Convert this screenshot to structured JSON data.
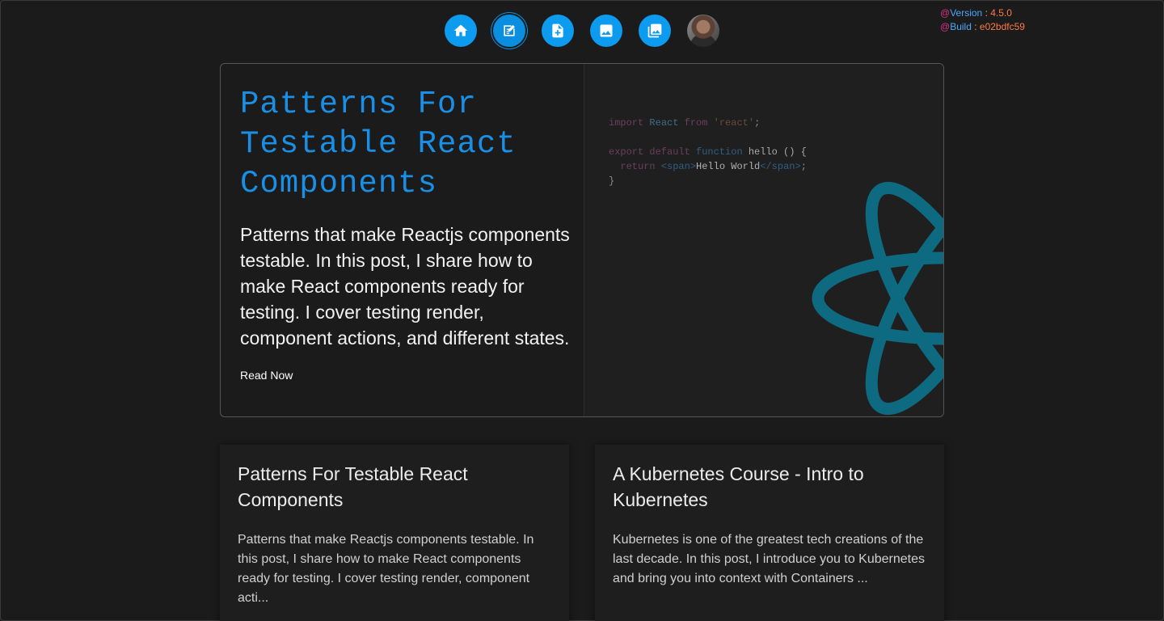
{
  "version_info": {
    "version_label": "Version",
    "version_value": "4.5.0",
    "build_label": "Build",
    "build_value": "e02bdfc59"
  },
  "nav": {
    "items": [
      {
        "icon": "home-icon"
      },
      {
        "icon": "edit-note-icon"
      },
      {
        "icon": "add-document-icon"
      },
      {
        "icon": "image-icon"
      },
      {
        "icon": "photo-library-icon"
      },
      {
        "icon": "avatar"
      }
    ]
  },
  "hero": {
    "title": "Patterns For Testable React Components",
    "description": "Patterns that make Reactjs components testable. In this post, I share how to make React components ready for testing. I cover testing render, component actions, and different states.",
    "link_label": "Read Now",
    "code": {
      "line1": {
        "kw": "import",
        "id": "React",
        "kw2": "from",
        "str": "'react'",
        "end": ";"
      },
      "line3": {
        "kw": "export default",
        "kw2": "function",
        "fn": "hello",
        "rest": " () {"
      },
      "line4": {
        "kw": "return",
        "tag_open": "<span>",
        "text": "Hello World",
        "tag_close": "</span>",
        "end": ";"
      },
      "line5": "}"
    }
  },
  "articles": [
    {
      "title": "Patterns For Testable React Components",
      "excerpt": "Patterns that make Reactjs components testable. In this post, I share how to make React components ready for testing. I cover testing render, component acti..."
    },
    {
      "title": "A Kubernetes Course - Intro to Kubernetes",
      "excerpt": "Kubernetes is one of the greatest tech creations of the last decade. In this post, I introduce you to Kubernetes and bring you into context with Containers ..."
    }
  ],
  "colors": {
    "accent": "#0d9bf0",
    "title_blue": "#1a8fe6",
    "background": "#1b1b1b",
    "react_teal": "#0e6a80"
  }
}
